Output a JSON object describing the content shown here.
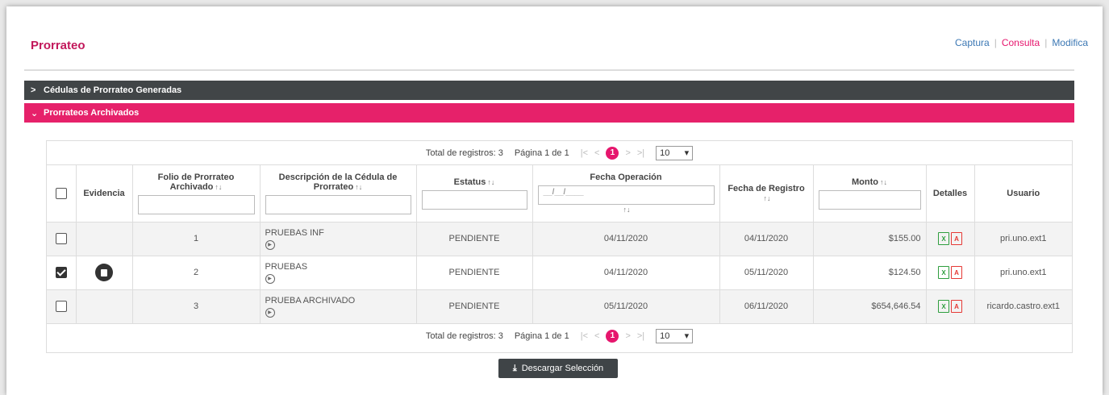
{
  "header": {
    "title": "Prorrateo",
    "nav": [
      {
        "label": "Captura"
      },
      {
        "label": "Consulta"
      },
      {
        "label": "Modifica"
      }
    ],
    "separator": "|"
  },
  "sections": {
    "generated": {
      "label": "Cédulas de Prorrateo Generadas",
      "icon": "chevron-right-icon"
    },
    "archived": {
      "label": "Prorrateos Archivados",
      "icon": "chevron-down-icon"
    }
  },
  "pager": {
    "total_label": "Total de registros: 3",
    "page_label": "Página 1 de 1",
    "current_page": "1",
    "page_size": "10",
    "first": "|<",
    "prev": "<",
    "next": ">",
    "last": ">|"
  },
  "table": {
    "headers": {
      "evidencia": "Evidencia",
      "folio": "Folio de Prorrateo Archivado",
      "descripcion": "Descripción de la Cédula de Prorrateo",
      "estatus": "Estatus",
      "fecha_operacion": "Fecha Operación",
      "fecha_registro": "Fecha de Registro",
      "monto": "Monto",
      "detalles": "Detalles",
      "usuario": "Usuario"
    },
    "sort_glyph": "↑↓",
    "fecha_placeholder": "__/__/____",
    "rows": [
      {
        "checked": false,
        "evidencia": false,
        "folio": "1",
        "descripcion": "PRUEBAS INF",
        "estatus": "PENDIENTE",
        "fecha_operacion": "04/11/2020",
        "fecha_registro": "04/11/2020",
        "monto": "$155.00",
        "usuario": "pri.uno.ext1"
      },
      {
        "checked": true,
        "evidencia": true,
        "folio": "2",
        "descripcion": "PRUEBAS",
        "estatus": "PENDIENTE",
        "fecha_operacion": "04/11/2020",
        "fecha_registro": "05/11/2020",
        "monto": "$124.50",
        "usuario": "pri.uno.ext1"
      },
      {
        "checked": false,
        "evidencia": false,
        "folio": "3",
        "descripcion": "PRUEBA ARCHIVADO",
        "estatus": "PENDIENTE",
        "fecha_operacion": "05/11/2020",
        "fecha_registro": "06/11/2020",
        "monto": "$654,646.54",
        "usuario": "ricardo.castro.ext1"
      }
    ]
  },
  "download_button": {
    "label": "Descargar Selección",
    "icon": "download-icon"
  },
  "colors": {
    "accent": "#e6216a",
    "dark_bar": "#414547",
    "title": "#c2185b",
    "link": "#3c78b4"
  }
}
